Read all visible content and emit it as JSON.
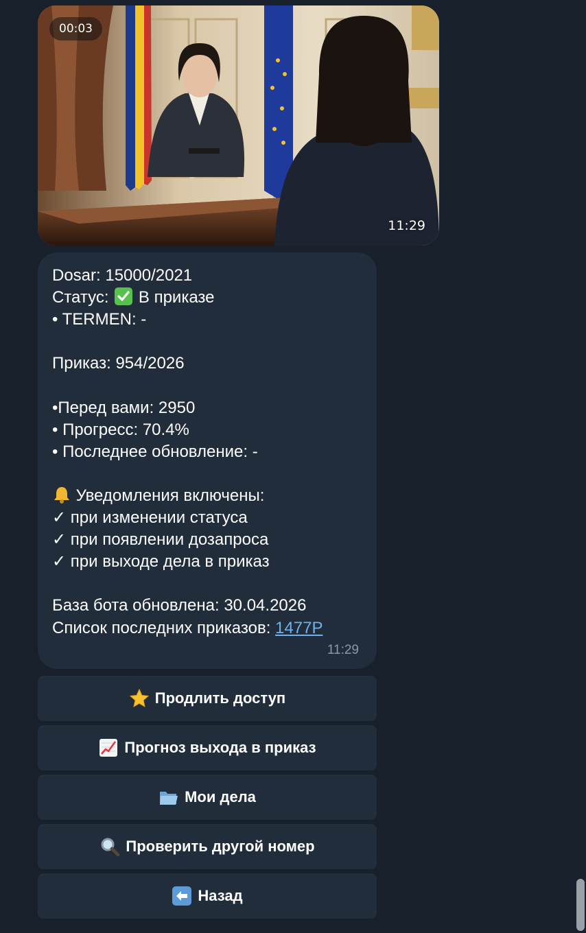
{
  "video": {
    "duration": "00:03",
    "timestamp": "11:29"
  },
  "message": {
    "lines": [
      "Dosar: 15000/2021",
      "Статус:",
      "В приказе",
      "• TERMEN: -",
      "Приказ: 954/2026",
      "•Перед вами: 2950",
      "• Прогресс: 70.4%",
      "• Последнее обновление: -",
      "Уведомления включены:",
      "✓ при изменении статуса",
      "✓ при появлении дозапроса",
      "✓ при выходе дела в приказ",
      "База бота обновлена: 30.04.2026",
      "Список последних приказов: "
    ],
    "link_text": "1477Р",
    "timestamp": "11:29"
  },
  "buttons": [
    {
      "label": "Продлить доступ",
      "icon": "star-icon"
    },
    {
      "label": "Прогноз выхода в приказ",
      "icon": "chart-increasing-icon"
    },
    {
      "label": "Мои дела",
      "icon": "folder-icon"
    },
    {
      "label": "Проверить другой номер",
      "icon": "magnifier-icon"
    },
    {
      "label": "Назад",
      "icon": "left-arrow-icon"
    }
  ],
  "colors": {
    "background": "#18202c",
    "bubble": "#212d3b",
    "link": "#6fb1ee",
    "timestamp": "#8b98a8"
  }
}
